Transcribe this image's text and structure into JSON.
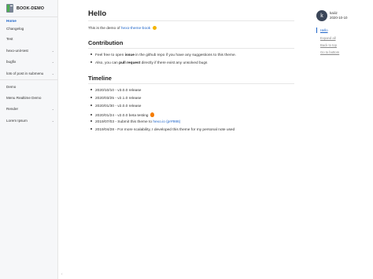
{
  "app": {
    "title": "BOOK-DEMO"
  },
  "sidebar": {
    "items": [
      {
        "label": "Home",
        "active": true,
        "has_children": false
      },
      {
        "label": "Changelog",
        "has_children": false
      },
      {
        "label": "Test",
        "has_children": false
      },
      {
        "label": "hexo-unit-test",
        "has_children": true
      },
      {
        "label": "bugfix",
        "has_children": true
      },
      {
        "label": "lots of post in submenu",
        "has_children": true
      },
      {
        "label": "Demo",
        "has_children": false
      },
      {
        "label": "Menu Realtime Demo",
        "has_children": false
      },
      {
        "label": "Render",
        "has_children": true
      },
      {
        "label": "Lorem Ipsum",
        "has_children": true
      }
    ],
    "collapse_icon": "chevron-left-icon",
    "caret_icon": "chevron-down-icon"
  },
  "main": {
    "title": "Hello",
    "intro_prefix": "This is the demo of ",
    "intro_link": "hexo-theme-book",
    "intro_emoji": "smile-emoji",
    "contribution": {
      "heading": "Contribution",
      "items": [
        {
          "pre": "Feel free to open ",
          "bold": "issue",
          "post": " in the github repo if you have any suggestions to this theme."
        },
        {
          "pre": "Also, you can ",
          "bold": "pull request",
          "post": " directly if there exist any unsolved bugs"
        }
      ]
    },
    "timeline": {
      "heading": "Timeline",
      "items": [
        "2020/10/10 - v3.0.0 release",
        "2020/03/25 - v2.1.0 release",
        "2020/01/30 - v2.0.0 release",
        "2020/01/24 - v2.0.0 beta testing"
      ],
      "submit_pre": "2019/07/03 - Submit this theme to ",
      "submit_link1": "hexo.io",
      "submit_link2": "(pr#986)",
      "last": "2019/04/28 - For more scalability, I developed this theme for my personal note used"
    }
  },
  "author": {
    "initial": "k",
    "name": "kaiiiz",
    "date": "2020-10-10"
  },
  "toc": {
    "active": "Hello",
    "links": [
      "Expand all",
      "Back to top",
      "Go to bottom"
    ]
  },
  "colors": {
    "accent": "#1e64c8",
    "sidebar_bg": "#f6f7f9"
  }
}
